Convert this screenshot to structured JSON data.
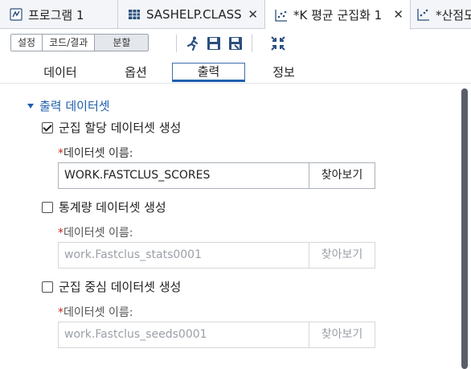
{
  "doc_tabs": [
    {
      "label": "프로그램 1",
      "icon": "program-icon",
      "close": ""
    },
    {
      "label": "SASHELP.CLASS",
      "icon": "table-icon",
      "close": "✕"
    },
    {
      "label": "*K 평균 군집화 1",
      "icon": "cluster-task-icon",
      "close": "✕",
      "active": true
    },
    {
      "label": "*산점도",
      "icon": "scatter-task-icon",
      "close": ""
    }
  ],
  "toolbar": {
    "view_modes": [
      "설정",
      "코드/결과",
      "분할"
    ],
    "selected_view": "분할",
    "icons": [
      "run-icon",
      "save-icon",
      "save-as-icon",
      "maximize-icon"
    ]
  },
  "subtabs": [
    "데이터",
    "옵션",
    "출력",
    "정보"
  ],
  "active_subtab": "출력",
  "section": {
    "title": "출력 데이터셋",
    "expanded": true
  },
  "outputs": [
    {
      "checkbox_label": "군집 할당 데이터셋 생성",
      "checked": true,
      "required_mark": "*",
      "field_label": "데이터셋 이름:",
      "value": "WORK.FASTCLUS_SCORES",
      "browse_label": "찾아보기"
    },
    {
      "checkbox_label": "통계량 데이터셋 생성",
      "checked": false,
      "required_mark": "*",
      "field_label": "데이터셋 이름:",
      "value": "work.Fastclus_stats0001",
      "browse_label": "찾아보기"
    },
    {
      "checkbox_label": "군집 중심 데이터셋 생성",
      "checked": false,
      "required_mark": "*",
      "field_label": "데이터셋 이름:",
      "value": "work.Fastclus_seeds0001",
      "browse_label": "찾아보기"
    }
  ],
  "colors": {
    "accent": "#1f5fae",
    "required": "#c0281d",
    "tab_bar": "#f3f5f8"
  }
}
